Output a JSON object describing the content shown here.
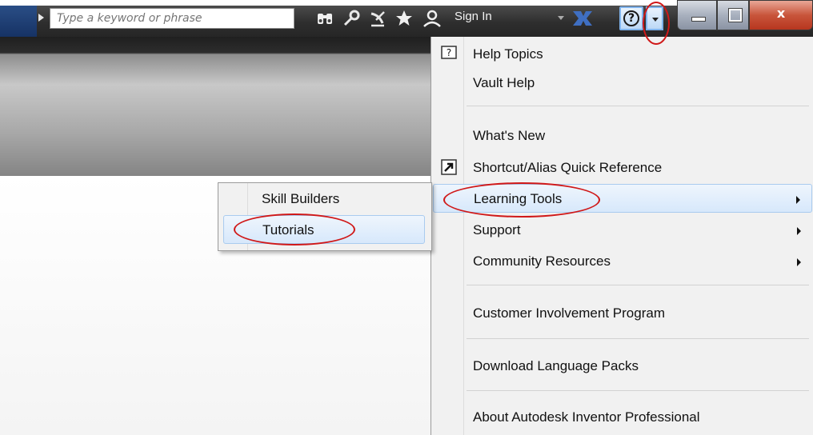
{
  "toolbar": {
    "search_placeholder": "Type a keyword or phrase",
    "sign_in_label": "Sign In",
    "icons": [
      "binoculars-icon",
      "key-icon",
      "satellite-icon",
      "star-icon",
      "user-icon",
      "exchange-icon",
      "help-icon"
    ]
  },
  "help_menu": {
    "items": [
      {
        "label": "Help Topics",
        "icon": "help-topics-icon"
      },
      {
        "label": "Vault Help"
      },
      {
        "label": "What's New"
      },
      {
        "label": "Shortcut/Alias Quick Reference",
        "icon": "shortcut-arrow-icon"
      },
      {
        "label": "Learning Tools",
        "submenu": true,
        "highlighted": true
      },
      {
        "label": "Support",
        "submenu": true
      },
      {
        "label": "Community Resources",
        "submenu": true
      },
      {
        "label": "Customer Involvement Program"
      },
      {
        "label": "Download Language Packs"
      },
      {
        "label": "About Autodesk Inventor Professional"
      }
    ]
  },
  "learning_tools_submenu": {
    "items": [
      {
        "label": "Skill Builders"
      },
      {
        "label": "Tutorials",
        "highlighted": true
      }
    ]
  },
  "colors": {
    "highlight": "#d7e8fb",
    "annotation": "#d01818",
    "titlebar": "#2e2e2e"
  }
}
